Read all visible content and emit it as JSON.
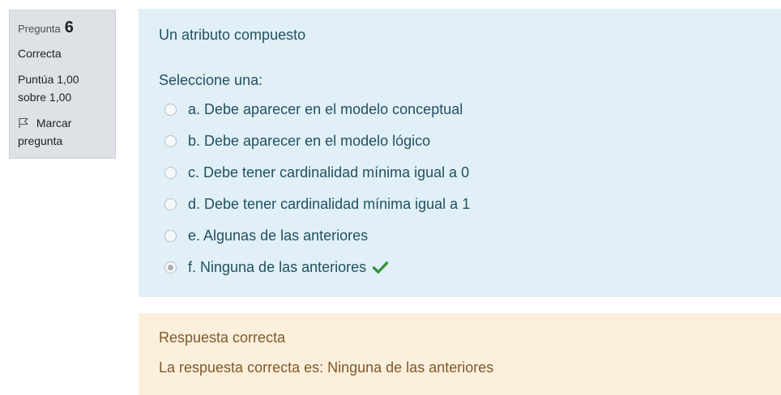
{
  "info": {
    "question_label": "Pregunta",
    "question_number": "6",
    "state": "Correcta",
    "grade_line1": "Puntúa 1,00",
    "grade_line2": "sobre 1,00",
    "flag_line1": "Marcar",
    "flag_line2": "pregunta",
    "flag_icon": "flag-outline-icon"
  },
  "question": {
    "text": "Un atributo compuesto",
    "prompt": "Seleccione una:",
    "options": [
      {
        "label": "a. Debe aparecer en el modelo conceptual",
        "selected": false
      },
      {
        "label": "b. Debe aparecer en el modelo lógico",
        "selected": false
      },
      {
        "label": "c. Debe tener cardinalidad mínima igual a 0",
        "selected": false
      },
      {
        "label": "d. Debe tener cardinalidad mínima igual a 1",
        "selected": false
      },
      {
        "label": "e. Algunas de las anteriores",
        "selected": false
      },
      {
        "label": "f. Ninguna de las anteriores",
        "selected": true,
        "correct_icon": "check-icon"
      }
    ]
  },
  "feedback": {
    "general": "Respuesta correcta",
    "right_answer": "La respuesta correcta es: Ninguna de las anteriores"
  },
  "colors": {
    "info_bg": "#dee2e6",
    "formulation_bg": "#e0f0f6",
    "formulation_text": "#235062",
    "feedback_bg": "#fcefdc",
    "feedback_text": "#7d5a29",
    "correct_green": "#3a8f3f"
  }
}
